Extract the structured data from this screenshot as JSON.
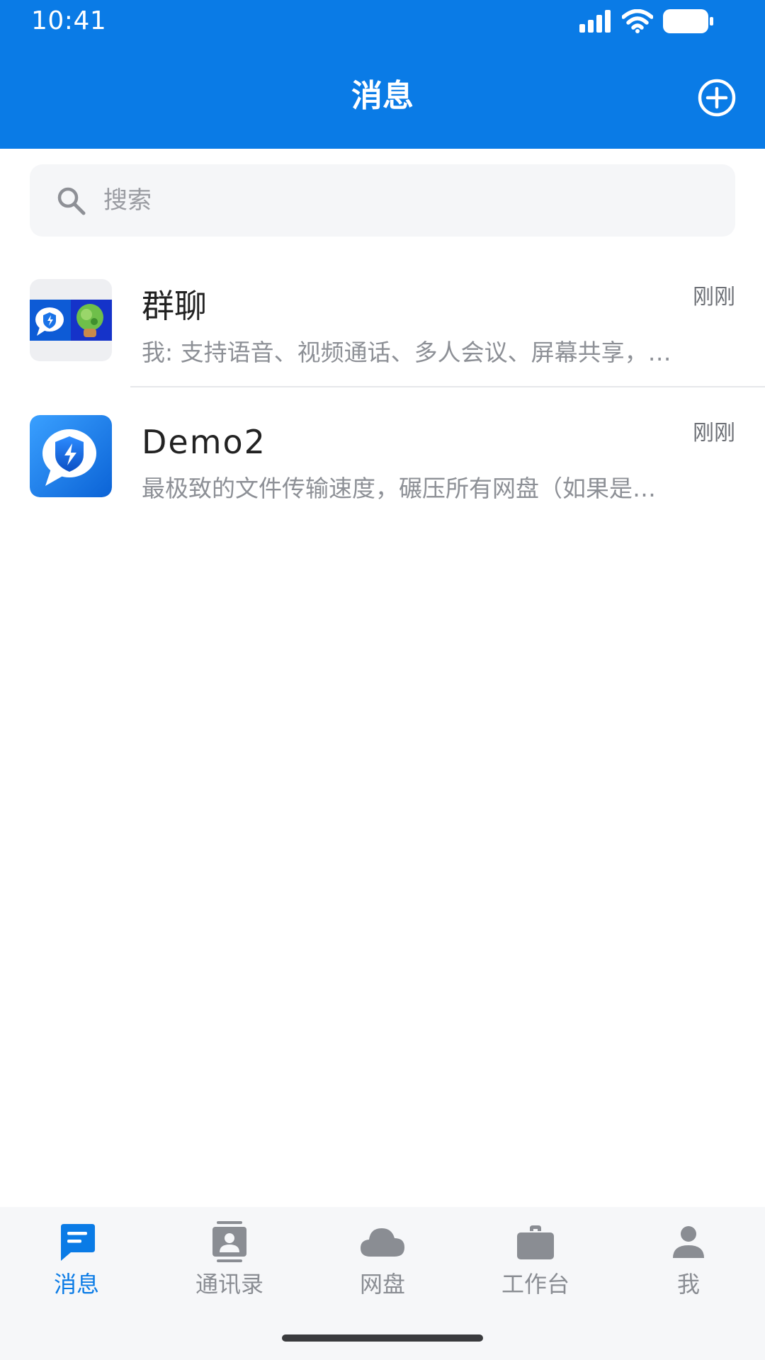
{
  "status_bar": {
    "time": "10:41"
  },
  "header": {
    "title": "消息",
    "add_icon": "plus-circle-icon"
  },
  "search": {
    "placeholder": "搜索",
    "value": ""
  },
  "conversations": [
    {
      "title": "群聊",
      "time": "刚刚",
      "preview": "我: 支持语音、视频通话、多人会议、屏幕共享，…",
      "avatar": "group-avatar"
    },
    {
      "title": "Demo2",
      "time": "刚刚",
      "preview": "最极致的文件传输速度，碾压所有网盘（如果是…",
      "avatar": "app-logo-avatar"
    }
  ],
  "tabs": [
    {
      "label": "消息",
      "icon": "message-icon",
      "active": true
    },
    {
      "label": "通讯录",
      "icon": "contacts-icon",
      "active": false
    },
    {
      "label": "网盘",
      "icon": "cloud-icon",
      "active": false
    },
    {
      "label": "工作台",
      "icon": "briefcase-icon",
      "active": false
    },
    {
      "label": "我",
      "icon": "person-icon",
      "active": false
    }
  ],
  "colors": {
    "primary": "#0a7be6",
    "tab_inactive": "#8a8d93",
    "tabbar_bg": "#f6f7f9",
    "search_bg": "#f5f6f8"
  }
}
